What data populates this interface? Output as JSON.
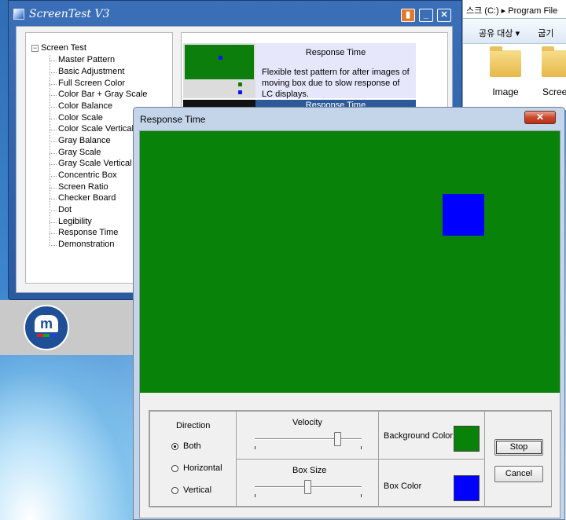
{
  "colors": {
    "canvas_green": "#088208",
    "box_blue": "#0000ff",
    "titlebar_blue": "#2a5aa0"
  },
  "explorer": {
    "path": "스크 (C:) ▸ Program File",
    "toolbar_label": "공유 대상 ▾",
    "toolbar_extra": "굽기",
    "files": [
      "Image",
      "Screen"
    ]
  },
  "screentest": {
    "title": "ScreenTest V3",
    "tree_root": "Screen Test",
    "tree_items": [
      "Master Pattern",
      "Basic Adjustment",
      "Full Screen Color",
      "Color Bar + Gray Scale",
      "Color Balance",
      "Color Scale",
      "Color Scale Vertical",
      "Gray Balance",
      "Gray Scale",
      "Gray Scale Vertical",
      "Concentric Box",
      "Screen Ratio",
      "Checker Board",
      "Dot",
      "Legibility",
      "Response Time",
      "Demonstration"
    ],
    "preview": {
      "card_title": "Response Time",
      "card_desc": "Flexible test pattern for after images of moving box due to slow response of LC displays.",
      "card2_title": "Response Time"
    },
    "logo_text": "m"
  },
  "dialog": {
    "title": "Response Time",
    "close_glyph": "✕",
    "direction": {
      "label": "Direction",
      "options": [
        "Both",
        "Horizontal",
        "Vertical"
      ],
      "selected": "Both"
    },
    "velocity": {
      "label": "Velocity",
      "value": 0.78
    },
    "box_size": {
      "label": "Box Size",
      "value": 0.5
    },
    "background_color_label": "Background Color",
    "box_color_label": "Box Color",
    "stop_label": "Stop",
    "cancel_label": "Cancel"
  }
}
